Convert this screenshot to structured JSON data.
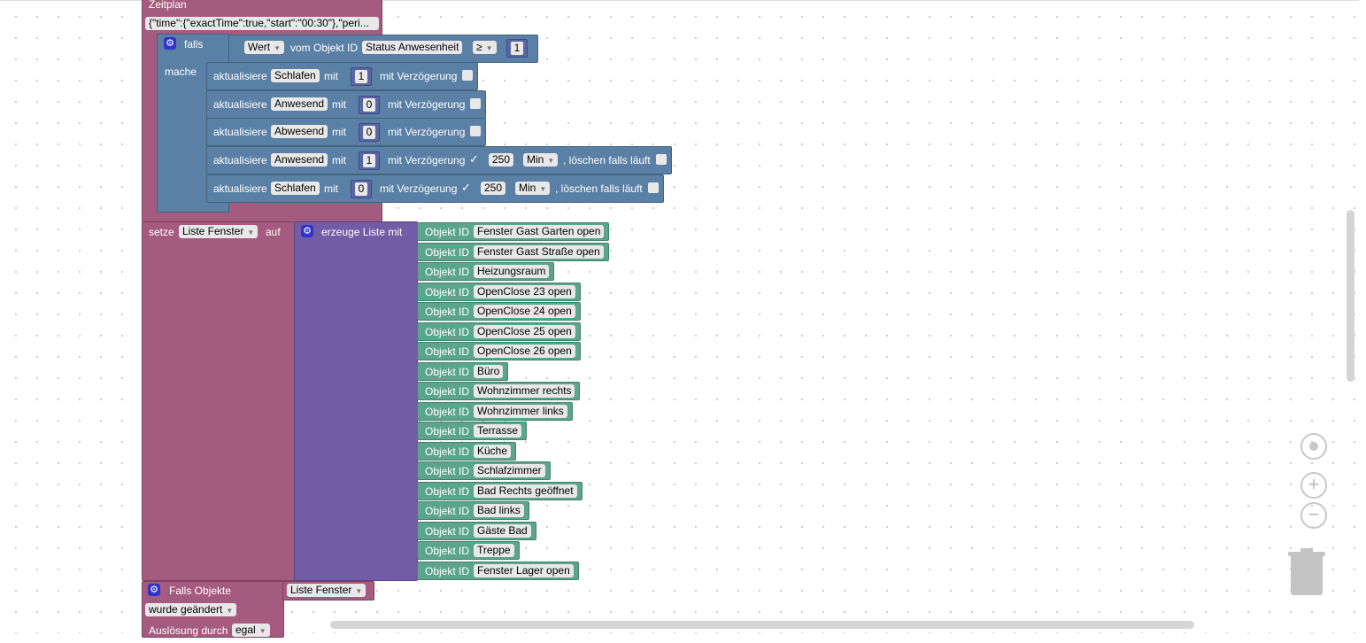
{
  "schedule": {
    "title": "Zeitplan",
    "cron": "{\"time\":{\"exactTime\":true,\"start\":\"00:30\"},\"peri..."
  },
  "if_block": {
    "falls": "falls",
    "mache": "mache",
    "cond_value": "Wert",
    "cond_from": "vom Objekt ID",
    "cond_object": "Status Anwesenheit",
    "cond_op": "≥",
    "cond_num": "1"
  },
  "updates": [
    {
      "verb": "aktualisiere",
      "name": "Schlafen",
      "mit": "mit",
      "value": "1",
      "delay": "mit Verzögerung"
    },
    {
      "verb": "aktualisiere",
      "name": "Anwesend",
      "mit": "mit",
      "value": "0",
      "delay": "mit Verzögerung"
    },
    {
      "verb": "aktualisiere",
      "name": "Abwesend",
      "mit": "mit",
      "value": "0",
      "delay": "mit Verzögerung"
    },
    {
      "verb": "aktualisiere",
      "name": "Anwesend",
      "mit": "mit",
      "value": "1",
      "delay": "mit Verzögerung",
      "check": "✓",
      "amount": "250",
      "unit": "Min",
      "clear": ", löschen falls läuft"
    },
    {
      "verb": "aktualisiere",
      "name": "Schlafen",
      "mit": "mit",
      "value": "0",
      "delay": "mit Verzögerung",
      "check": "✓",
      "amount": "250",
      "unit": "Min",
      "clear": ", löschen falls läuft"
    }
  ],
  "set_block": {
    "setze": "setze",
    "var": "Liste Fenster",
    "auf": "auf",
    "create": "erzeuge Liste mit"
  },
  "object_label": "Objekt ID",
  "objects": [
    "Fenster Gast Garten open",
    "Fenster Gast Straße open",
    "Heizungsraum",
    "OpenClose 23 open",
    "OpenClose 24 open",
    "OpenClose 25 open",
    "OpenClose 26 open",
    "Büro",
    "Wohnzimmer rechts",
    "Wohnzimmer links",
    "Terrasse",
    "Küche",
    "Schlafzimmer",
    "Bad Rechts geöffnet",
    "Bad links",
    "Gäste Bad",
    "Treppe",
    "Fenster Lager open"
  ],
  "trigger": {
    "title": "Falls Objekte",
    "list": "Liste Fenster",
    "changed": "wurde geändert",
    "cause_label": "Auslösung durch",
    "cause_value": "egal"
  },
  "icons": {
    "gear": "gear-icon",
    "center": "center-icon",
    "zoom_in": "zoom-in-icon",
    "zoom_out": "zoom-out-icon",
    "trash": "trash-icon"
  },
  "colors": {
    "event": "#a55b80",
    "logic": "#5b80a5",
    "list": "#745ba5",
    "object": "#5ba58c"
  }
}
